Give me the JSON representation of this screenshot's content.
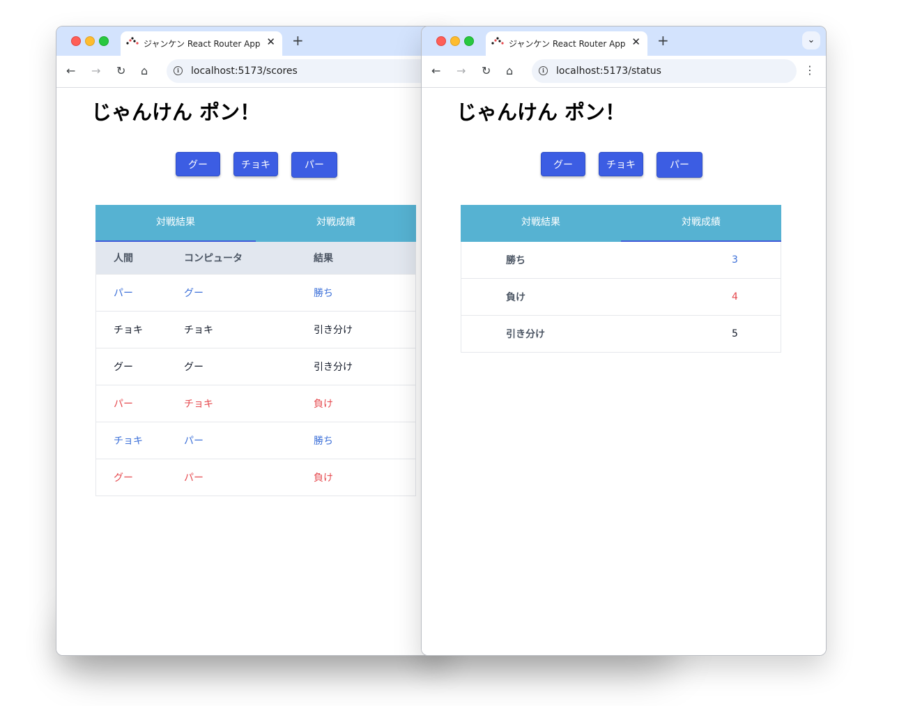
{
  "colors": {
    "win": "#3b6fd8",
    "lose": "#e5484d",
    "draw": "#111827",
    "button": "#3c5de3",
    "tab_bar": "#56b2d2"
  },
  "windows": [
    {
      "id": "left",
      "tab_title": "ジャンケン React Router App",
      "url": "localhost:5173/scores",
      "page_title": "じゃんけん ポン！",
      "buttons": [
        "グー",
        "チョキ",
        "パー"
      ],
      "tabs": [
        {
          "label": "対戦結果",
          "active": true
        },
        {
          "label": "対戦成績",
          "active": false
        }
      ],
      "table": {
        "headers": [
          "人間",
          "コンピュータ",
          "結果"
        ],
        "rows": [
          {
            "human": "パー",
            "computer": "グー",
            "result": "勝ち",
            "outcome": "win"
          },
          {
            "human": "チョキ",
            "computer": "チョキ",
            "result": "引き分け",
            "outcome": "draw"
          },
          {
            "human": "グー",
            "computer": "グー",
            "result": "引き分け",
            "outcome": "draw"
          },
          {
            "human": "パー",
            "computer": "チョキ",
            "result": "負け",
            "outcome": "lose"
          },
          {
            "human": "チョキ",
            "computer": "パー",
            "result": "勝ち",
            "outcome": "win"
          },
          {
            "human": "グー",
            "computer": "パー",
            "result": "負け",
            "outcome": "lose"
          }
        ]
      }
    },
    {
      "id": "right",
      "tab_title": "ジャンケン React Router App",
      "url": "localhost:5173/status",
      "page_title": "じゃんけん ポン！",
      "buttons": [
        "グー",
        "チョキ",
        "パー"
      ],
      "tabs": [
        {
          "label": "対戦結果",
          "active": false
        },
        {
          "label": "対戦成績",
          "active": true
        }
      ],
      "status": [
        {
          "label": "勝ち",
          "value": "3",
          "outcome": "win"
        },
        {
          "label": "負け",
          "value": "4",
          "outcome": "lose"
        },
        {
          "label": "引き分け",
          "value": "5",
          "outcome": "draw"
        }
      ]
    }
  ],
  "icons": {
    "back": "arrow-left-icon",
    "forward": "arrow-right-icon",
    "reload": "reload-icon",
    "home": "home-icon",
    "info": "info-icon",
    "close": "close-icon",
    "new_tab": "plus-icon",
    "tab_search": "chevron-down-icon",
    "menu": "kebab-menu-icon"
  }
}
